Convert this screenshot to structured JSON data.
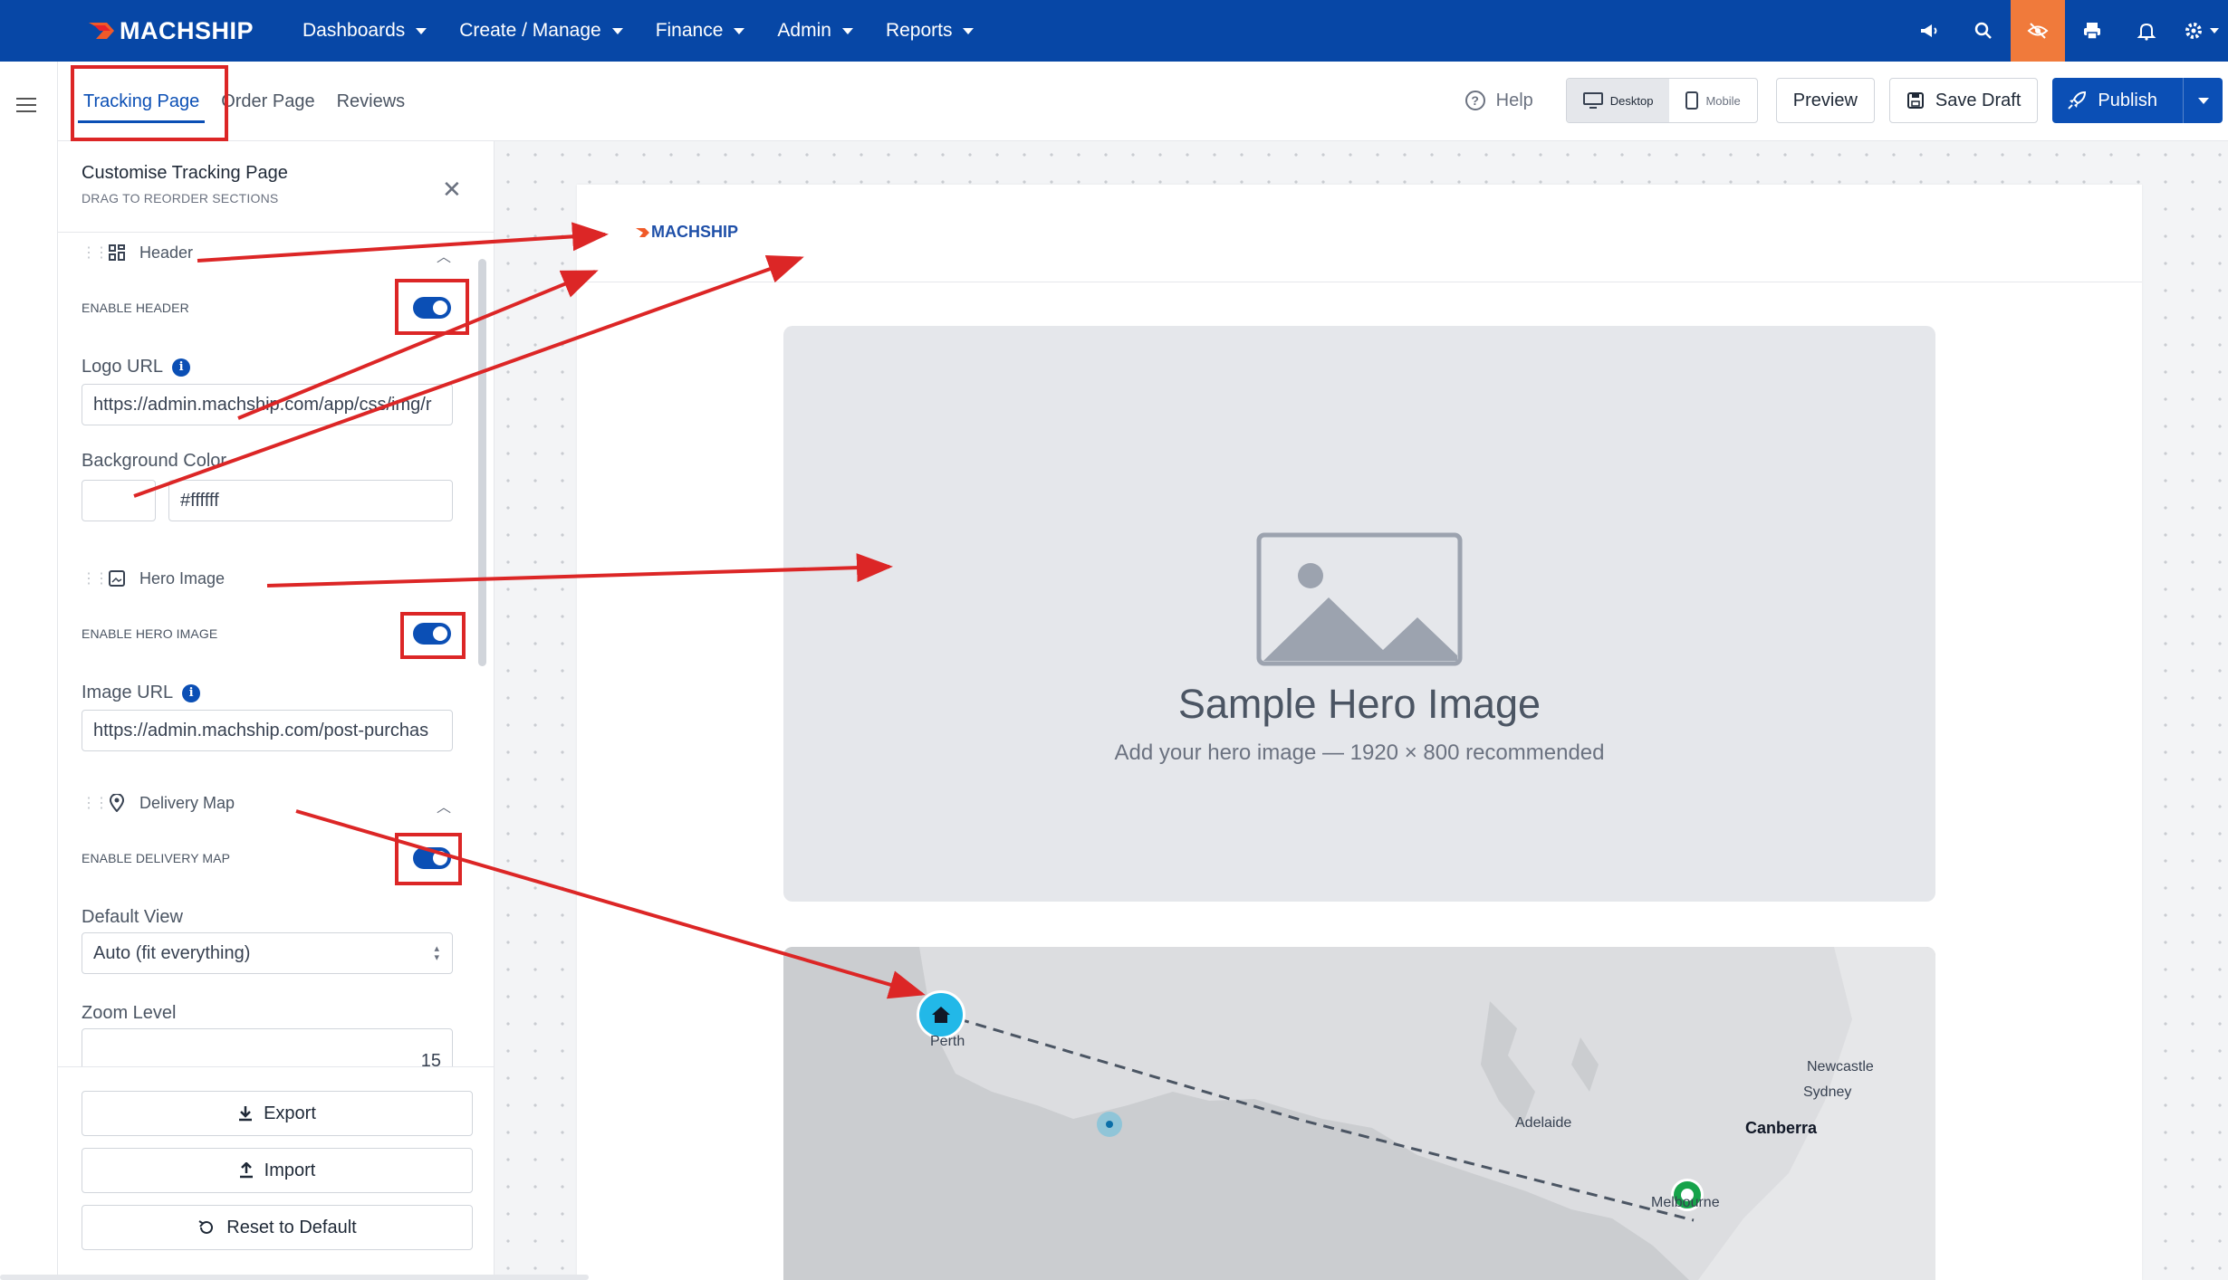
{
  "app": {
    "brand": "MACHSHIP"
  },
  "nav": {
    "items": [
      {
        "label": "Dashboards"
      },
      {
        "label": "Create / Manage"
      },
      {
        "label": "Finance"
      },
      {
        "label": "Admin"
      },
      {
        "label": "Reports"
      }
    ],
    "icons": [
      "megaphone-icon",
      "search-icon",
      "eye-off-icon",
      "print-icon",
      "bell-icon",
      "gear-icon"
    ]
  },
  "toolbar": {
    "tabs": [
      {
        "label": "Tracking Page",
        "active": true
      },
      {
        "label": "Order Page",
        "active": false
      },
      {
        "label": "Reviews",
        "active": false
      }
    ],
    "help_label": "Help",
    "device": {
      "desktop": "Desktop",
      "mobile": "Mobile",
      "selected": "Desktop"
    },
    "preview_label": "Preview",
    "save_draft_label": "Save Draft",
    "publish_label": "Publish"
  },
  "panel": {
    "title": "Customise Tracking Page",
    "subtitle": "DRAG TO REORDER SECTIONS",
    "header_section": {
      "label": "Header",
      "enable_label": "ENABLE HEADER",
      "enabled": true,
      "logo_url_label": "Logo URL",
      "logo_url_value": "https://admin.machship.com/app/css/img/r",
      "bg_color_label": "Background Color",
      "bg_color_value": "#ffffff"
    },
    "hero_section": {
      "label": "Hero Image",
      "enable_label": "ENABLE HERO IMAGE",
      "enabled": true,
      "image_url_label": "Image URL",
      "image_url_value": "https://admin.machship.com/post-purchas"
    },
    "map_section": {
      "label": "Delivery Map",
      "enable_label": "ENABLE DELIVERY MAP",
      "enabled": true,
      "default_view_label": "Default View",
      "default_view_value": "Auto (fit everything)",
      "zoom_label": "Zoom Level",
      "zoom_value": "15"
    },
    "footer": {
      "export_label": "Export",
      "import_label": "Import",
      "reset_label": "Reset to Default"
    }
  },
  "preview": {
    "logo_text": "MACHSHIP",
    "hero_title": "Sample Hero Image",
    "hero_subtitle": "Add your hero image — 1920 × 800 recommended",
    "map_labels": {
      "perth": "Perth",
      "adelaide": "Adelaide",
      "newcastle": "Newcastle",
      "sydney": "Sydney",
      "canberra": "Canberra",
      "melbourne": "Melbourne"
    }
  },
  "colors": {
    "nav_bg": "#0747a6",
    "accent": "#0b4fb5",
    "active_icon_bg": "#f07a3b",
    "annotation": "#dc2626",
    "origin_marker": "#22b8e8",
    "destination_marker": "#16a34a"
  }
}
